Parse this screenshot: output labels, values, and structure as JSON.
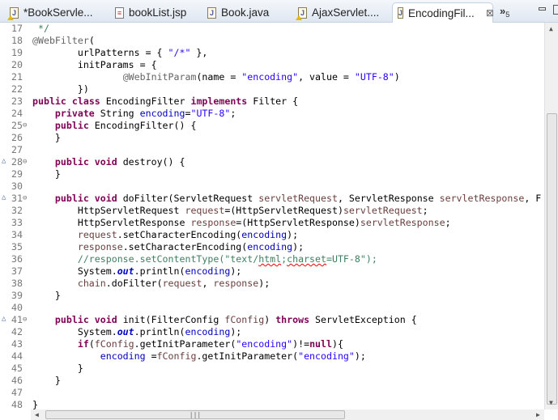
{
  "tabs": [
    {
      "label": "*BookServle...",
      "icon": "java-file-warning-icon",
      "active": false
    },
    {
      "label": "bookList.jsp",
      "icon": "jsp-file-icon",
      "active": false
    },
    {
      "label": "Book.java",
      "icon": "java-file-icon",
      "active": false
    },
    {
      "label": "AjaxServlet....",
      "icon": "java-file-warning-icon",
      "active": false
    },
    {
      "label": "EncodingFil...",
      "icon": "java-file-icon",
      "active": true
    }
  ],
  "overflow": {
    "label": "»",
    "count": "5"
  },
  "code_lines": [
    {
      "n": "17",
      "t": [
        [
          "c",
          " */"
        ]
      ]
    },
    {
      "n": "18",
      "t": [
        [
          "a",
          "@WebFilter"
        ],
        [
          "p",
          "("
        ]
      ]
    },
    {
      "n": "19",
      "t": [
        [
          "p",
          "        urlPatterns = { "
        ],
        [
          "s",
          "\"/*\""
        ],
        [
          "p",
          " },"
        ]
      ]
    },
    {
      "n": "20",
      "t": [
        [
          "p",
          "        initParams = {"
        ]
      ]
    },
    {
      "n": "21",
      "t": [
        [
          "p",
          "                "
        ],
        [
          "a",
          "@WebInitParam"
        ],
        [
          "p",
          "(name = "
        ],
        [
          "s",
          "\"encoding\""
        ],
        [
          "p",
          ", value = "
        ],
        [
          "s",
          "\"UTF-8\""
        ],
        [
          "p",
          ")"
        ]
      ]
    },
    {
      "n": "22",
      "t": [
        [
          "p",
          "        })"
        ]
      ]
    },
    {
      "n": "23",
      "t": [
        [
          "k",
          "public"
        ],
        [
          "p",
          " "
        ],
        [
          "k",
          "class"
        ],
        [
          "p",
          " EncodingFilter "
        ],
        [
          "k",
          "implements"
        ],
        [
          "p",
          " Filter {"
        ]
      ]
    },
    {
      "n": "24",
      "t": [
        [
          "p",
          "    "
        ],
        [
          "k",
          "private"
        ],
        [
          "p",
          " String "
        ],
        [
          "f",
          "encoding"
        ],
        [
          "p",
          "="
        ],
        [
          "s",
          "\"UTF-8\""
        ],
        [
          "p",
          ";"
        ]
      ]
    },
    {
      "n": "25",
      "fold": true,
      "t": [
        [
          "p",
          "    "
        ],
        [
          "k",
          "public"
        ],
        [
          "p",
          " EncodingFilter() {"
        ]
      ]
    },
    {
      "n": "26",
      "t": [
        [
          "p",
          "    }"
        ]
      ]
    },
    {
      "n": "27",
      "t": []
    },
    {
      "n": "28",
      "fold": true,
      "override": true,
      "t": [
        [
          "p",
          "    "
        ],
        [
          "k",
          "public"
        ],
        [
          "p",
          " "
        ],
        [
          "k",
          "void"
        ],
        [
          "p",
          " destroy() {"
        ]
      ]
    },
    {
      "n": "29",
      "t": [
        [
          "p",
          "    }"
        ]
      ]
    },
    {
      "n": "30",
      "t": []
    },
    {
      "n": "31",
      "fold": true,
      "override": true,
      "t": [
        [
          "p",
          "    "
        ],
        [
          "k",
          "public"
        ],
        [
          "p",
          " "
        ],
        [
          "k",
          "void"
        ],
        [
          "p",
          " doFilter(ServletRequest "
        ],
        [
          "v",
          "servletRequest"
        ],
        [
          "p",
          ", ServletResponse "
        ],
        [
          "v",
          "servletResponse"
        ],
        [
          "p",
          ", F"
        ]
      ]
    },
    {
      "n": "32",
      "t": [
        [
          "p",
          "        HttpServletRequest "
        ],
        [
          "v",
          "request"
        ],
        [
          "p",
          "=(HttpServletRequest)"
        ],
        [
          "v",
          "servletRequest"
        ],
        [
          "p",
          ";"
        ]
      ]
    },
    {
      "n": "33",
      "t": [
        [
          "p",
          "        HttpServletResponse "
        ],
        [
          "v",
          "response"
        ],
        [
          "p",
          "=(HttpServletResponse)"
        ],
        [
          "v",
          "servletResponse"
        ],
        [
          "p",
          ";"
        ]
      ]
    },
    {
      "n": "34",
      "t": [
        [
          "p",
          "        "
        ],
        [
          "v",
          "request"
        ],
        [
          "p",
          ".setCharacterEncoding("
        ],
        [
          "f",
          "encoding"
        ],
        [
          "p",
          ");"
        ]
      ]
    },
    {
      "n": "35",
      "t": [
        [
          "p",
          "        "
        ],
        [
          "v",
          "response"
        ],
        [
          "p",
          ".setCharacterEncoding("
        ],
        [
          "f",
          "encoding"
        ],
        [
          "p",
          ");"
        ]
      ]
    },
    {
      "n": "36",
      "t": [
        [
          "c",
          "        //response.setContentType(\"text/"
        ],
        [
          "c sq",
          "html"
        ],
        [
          "c",
          ";"
        ],
        [
          "c sq",
          "charset"
        ],
        [
          "c",
          "=UTF-8\");"
        ]
      ]
    },
    {
      "n": "37",
      "t": [
        [
          "p",
          "        System."
        ],
        [
          "i",
          "out"
        ],
        [
          "p",
          ".println("
        ],
        [
          "f",
          "encoding"
        ],
        [
          "p",
          ");"
        ]
      ]
    },
    {
      "n": "38",
      "t": [
        [
          "p",
          "        "
        ],
        [
          "v",
          "chain"
        ],
        [
          "p",
          ".doFilter("
        ],
        [
          "v",
          "request"
        ],
        [
          "p",
          ", "
        ],
        [
          "v",
          "response"
        ],
        [
          "p",
          ");"
        ]
      ]
    },
    {
      "n": "39",
      "t": [
        [
          "p",
          "    }"
        ]
      ]
    },
    {
      "n": "40",
      "t": []
    },
    {
      "n": "41",
      "fold": true,
      "override": true,
      "t": [
        [
          "p",
          "    "
        ],
        [
          "k",
          "public"
        ],
        [
          "p",
          " "
        ],
        [
          "k",
          "void"
        ],
        [
          "p",
          " init(FilterConfig "
        ],
        [
          "v",
          "fConfig"
        ],
        [
          "p",
          ") "
        ],
        [
          "k",
          "throws"
        ],
        [
          "p",
          " ServletException {"
        ]
      ]
    },
    {
      "n": "42",
      "t": [
        [
          "p",
          "        System."
        ],
        [
          "i",
          "out"
        ],
        [
          "p",
          ".println("
        ],
        [
          "f",
          "encoding"
        ],
        [
          "p",
          ");"
        ]
      ]
    },
    {
      "n": "43",
      "t": [
        [
          "p",
          "        "
        ],
        [
          "k",
          "if"
        ],
        [
          "p",
          "("
        ],
        [
          "v",
          "fConfig"
        ],
        [
          "p",
          ".getInitParameter("
        ],
        [
          "s",
          "\"encoding\""
        ],
        [
          "p",
          ")!="
        ],
        [
          "k",
          "null"
        ],
        [
          "p",
          "){"
        ]
      ]
    },
    {
      "n": "44",
      "t": [
        [
          "p",
          "            "
        ],
        [
          "f",
          "encoding"
        ],
        [
          "p",
          " ="
        ],
        [
          "v",
          "fConfig"
        ],
        [
          "p",
          ".getInitParameter("
        ],
        [
          "s",
          "\"encoding\""
        ],
        [
          "p",
          ");"
        ]
      ]
    },
    {
      "n": "45",
      "t": [
        [
          "p",
          "        }"
        ]
      ]
    },
    {
      "n": "46",
      "t": [
        [
          "p",
          "    }"
        ]
      ]
    },
    {
      "n": "47",
      "t": []
    },
    {
      "n": "48",
      "t": [
        [
          "p",
          "}"
        ]
      ]
    }
  ]
}
